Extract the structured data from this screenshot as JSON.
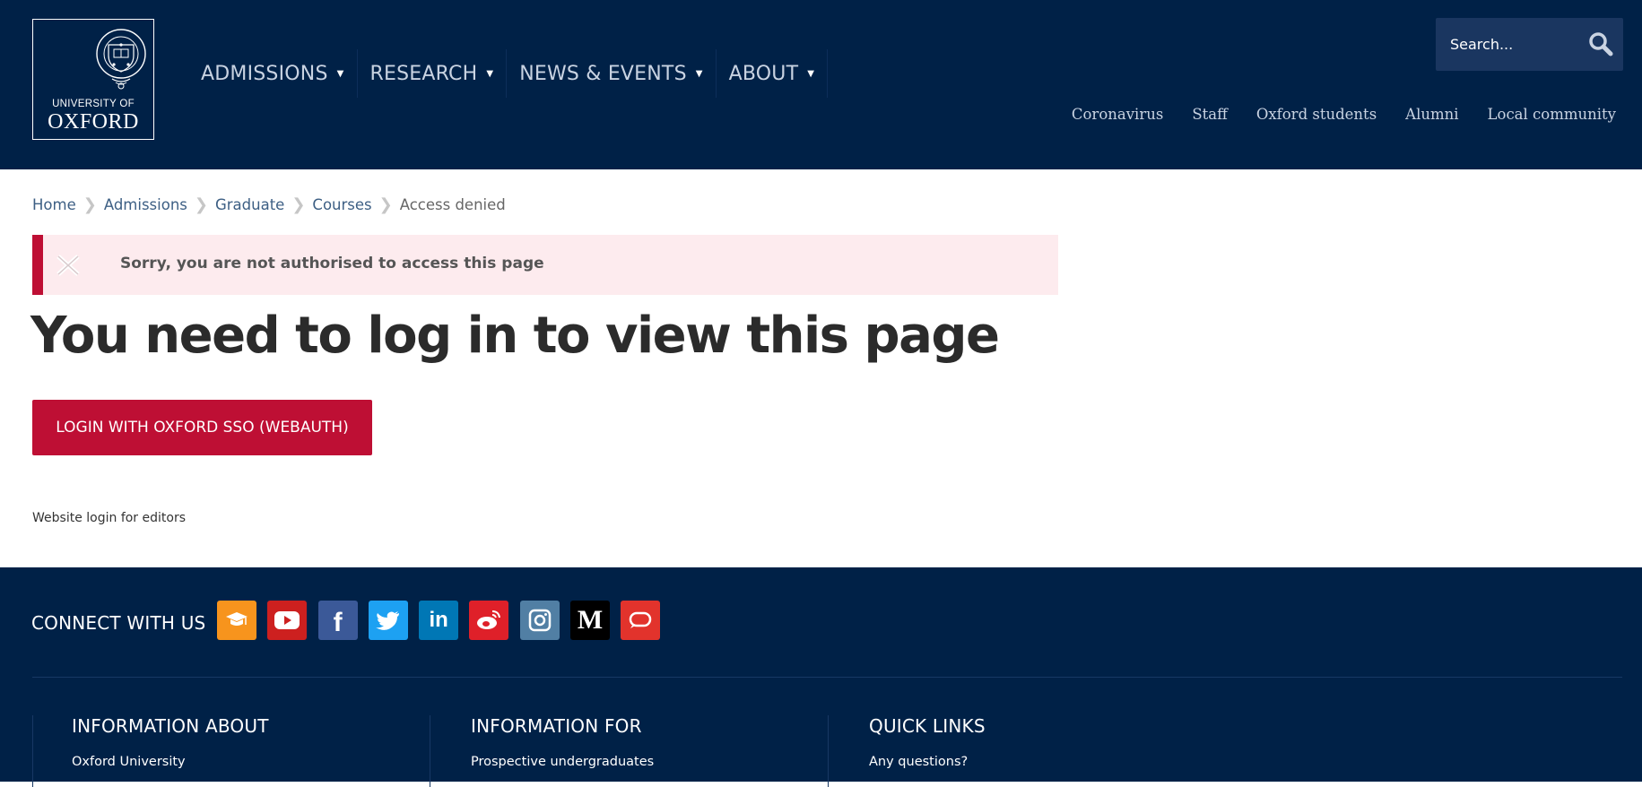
{
  "logo": {
    "line1": "UNIVERSITY OF",
    "line2": "OXFORD"
  },
  "main_nav": [
    {
      "label": "ADMISSIONS"
    },
    {
      "label": "RESEARCH"
    },
    {
      "label": "NEWS & EVENTS"
    },
    {
      "label": "ABOUT"
    }
  ],
  "search": {
    "placeholder": "Search...",
    "icon": "search-icon"
  },
  "utility_nav": [
    "Coronavirus",
    "Staff",
    "Oxford students",
    "Alumni",
    "Local community"
  ],
  "breadcrumb": {
    "items": [
      "Home",
      "Admissions",
      "Graduate",
      "Courses"
    ],
    "current": "Access denied"
  },
  "alert": {
    "message": "Sorry, you are not authorised to access this page",
    "icon": "close-icon"
  },
  "page_title": "You need to log in to view this page",
  "login_button": "LOGIN WITH OXFORD SSO (WEBAUTH)",
  "editors_link": "Website login for editors",
  "footer": {
    "connect_label": "CONNECT WITH US",
    "social": [
      {
        "name": "itunes-u-icon",
        "color": "#f7941d"
      },
      {
        "name": "youtube-icon",
        "color": "#cd201f"
      },
      {
        "name": "facebook-icon",
        "color": "#3b5998"
      },
      {
        "name": "twitter-icon",
        "color": "#1da1f2"
      },
      {
        "name": "linkedin-icon",
        "color": "#0077b5"
      },
      {
        "name": "weibo-icon",
        "color": "#df2029"
      },
      {
        "name": "instagram-icon",
        "color": "#517fa4"
      },
      {
        "name": "medium-icon",
        "color": "#000000"
      },
      {
        "name": "chat-icon",
        "color": "#e2332c"
      }
    ],
    "columns": [
      {
        "heading": "INFORMATION ABOUT",
        "first_link": "Oxford University"
      },
      {
        "heading": "INFORMATION FOR",
        "first_link": "Prospective undergraduates"
      },
      {
        "heading": "QUICK LINKS",
        "first_link": "Any questions?"
      }
    ]
  },
  "colors": {
    "navy": "#002147",
    "accent_red": "#be0f34",
    "alert_bg": "#fdebee"
  }
}
